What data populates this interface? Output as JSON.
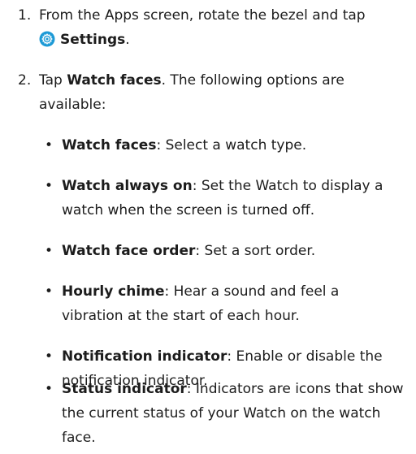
{
  "steps": [
    {
      "number": "1.",
      "text_before": "From the Apps screen, rotate the bezel and tap",
      "icon": "settings-gear-icon",
      "bold": "Settings",
      "text_after": "."
    },
    {
      "number": "2.",
      "text_before": "Tap ",
      "bold": "Watch faces",
      "text_after": ". The following options are available:"
    }
  ],
  "options": [
    {
      "label": "Watch faces",
      "description": ": Select a watch type."
    },
    {
      "label": "Watch always on",
      "description": ": Set the Watch to display a watch when the screen is turned off."
    },
    {
      "label": "Watch face order",
      "description": ": Set a sort order."
    },
    {
      "label": "Hourly chime",
      "description": ": Hear a sound and feel a vibration at the start of each hour."
    },
    {
      "label": "Notification indicator",
      "description": ": Enable or disable the notification indicator."
    },
    {
      "label": "Status indicator",
      "description": ": Indicators are icons that show the current status of your Watch on the watch face."
    }
  ],
  "bullet_char": "•",
  "colors": {
    "text": "#1c1c1c",
    "icon": "#1d9ad6"
  }
}
